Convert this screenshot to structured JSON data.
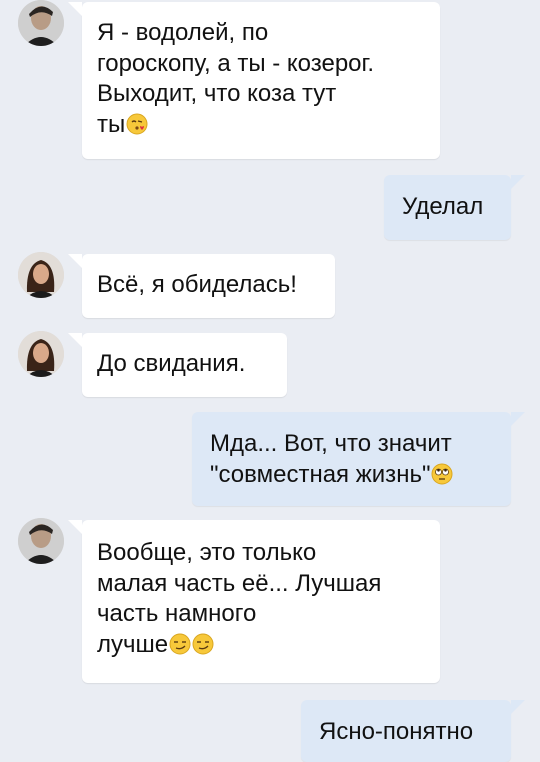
{
  "messages": [
    {
      "dir": "in",
      "sender": "male",
      "text": "Я - водолей, по\nгороскопу, а ты - козерог.\nВыходит, что коза тут\nты",
      "emoji": [
        "kiss-face-emoji"
      ]
    },
    {
      "dir": "out",
      "text": "Уделал",
      "emoji": []
    },
    {
      "dir": "in",
      "sender": "female",
      "text": "Всё, я обиделась!",
      "emoji": []
    },
    {
      "dir": "in",
      "sender": "female",
      "text": "До свидания.",
      "emoji": []
    },
    {
      "dir": "out",
      "text": "Мда... Вот, что значит\n\"совместная жизнь\"",
      "emoji": [
        "rolling-eyes-emoji"
      ]
    },
    {
      "dir": "in",
      "sender": "male",
      "text": "Вообще, это только\nмалая часть её... Лучшая\nчасть намного\nлучше",
      "emoji": [
        "smirk-emoji",
        "smirk-emoji"
      ]
    },
    {
      "dir": "out",
      "text": "Ясно-понятно",
      "emoji": []
    }
  ],
  "colors": {
    "background": "#eaedf3",
    "incoming_bubble": "#ffffff",
    "outgoing_bubble": "#dde8f6",
    "text": "#111111"
  }
}
